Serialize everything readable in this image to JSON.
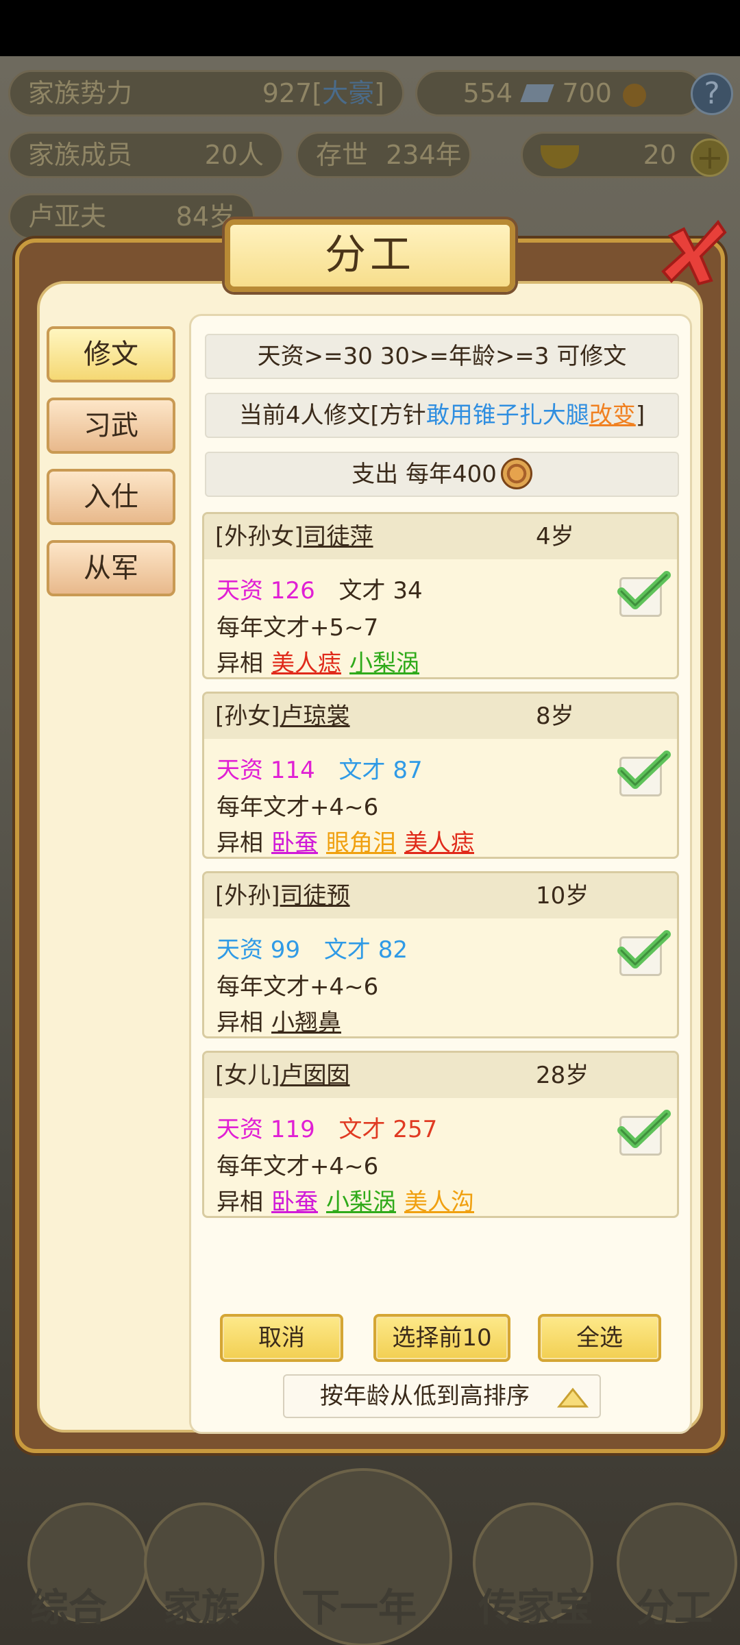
{
  "background": {
    "family_power_label": "家族势力",
    "family_power_value": "927[",
    "family_power_rank": "大豪",
    "family_power_close": "]",
    "currency_text": "554",
    "currency_text2": "700",
    "help_label": "?",
    "members_label": "家族成员",
    "members_value": "20人",
    "exist_label": "存世",
    "exist_value": "234年",
    "gold_value": "20",
    "leader_name": "卢亚夫",
    "leader_age": "84岁",
    "bottom_nav": [
      "综合",
      "家族",
      "下一年",
      "传家宝",
      "分工"
    ]
  },
  "dialog": {
    "title": "分工",
    "tabs": [
      {
        "label": "修文",
        "active": true
      },
      {
        "label": "习武",
        "active": false
      },
      {
        "label": "入仕",
        "active": false
      },
      {
        "label": "从军",
        "active": false
      }
    ],
    "requirement": "天资>=30 30>=年龄>=3 可修文",
    "current_prefix": "当前4人修文[方针",
    "current_policy": "敢用锥子扎大腿",
    "current_change": "改变",
    "current_suffix": "]",
    "expense": "支出 每年400",
    "members": [
      {
        "relation": "[外孙女]",
        "name": "司徒萍",
        "age": "4岁",
        "aptitude": "天资 126",
        "literary": "文才 34",
        "growth": "每年文才+5~7",
        "traits_label": "异相",
        "traits": [
          {
            "text": "美人痣",
            "cls": "t-red"
          },
          {
            "text": "小梨涡",
            "cls": "t-green"
          }
        ],
        "checked": true
      },
      {
        "relation": "[孙女]",
        "name": "卢琼裳",
        "age": "8岁",
        "aptitude": "天资 114",
        "literary": "文才 87",
        "growth": "每年文才+4~6",
        "traits_label": "异相",
        "traits": [
          {
            "text": "卧蚕",
            "cls": "t-magenta"
          },
          {
            "text": "眼角泪",
            "cls": "t-orange"
          },
          {
            "text": "美人痣",
            "cls": "t-red"
          }
        ],
        "checked": true
      },
      {
        "relation": "[外孙]",
        "name": "司徒预",
        "age": "10岁",
        "aptitude": "天资 99",
        "literary": "文才 82",
        "growth": "每年文才+4~6",
        "traits_label": "异相",
        "traits": [
          {
            "text": "小翘鼻",
            "cls": "t-dark"
          }
        ],
        "checked": true
      },
      {
        "relation": "[女儿]",
        "name": "卢囡囡",
        "age": "28岁",
        "aptitude": "天资 119",
        "literary": "文才 257",
        "growth": "每年文才+4~6",
        "traits_label": "异相",
        "traits": [
          {
            "text": "卧蚕",
            "cls": "t-magenta"
          },
          {
            "text": "小梨涡",
            "cls": "t-green"
          },
          {
            "text": "美人沟",
            "cls": "t-orange"
          }
        ],
        "checked": true
      }
    ],
    "buttons": {
      "cancel": "取消",
      "select_top10": "选择前10",
      "select_all": "全选"
    },
    "sort_label": "按年龄从低到高排序"
  }
}
